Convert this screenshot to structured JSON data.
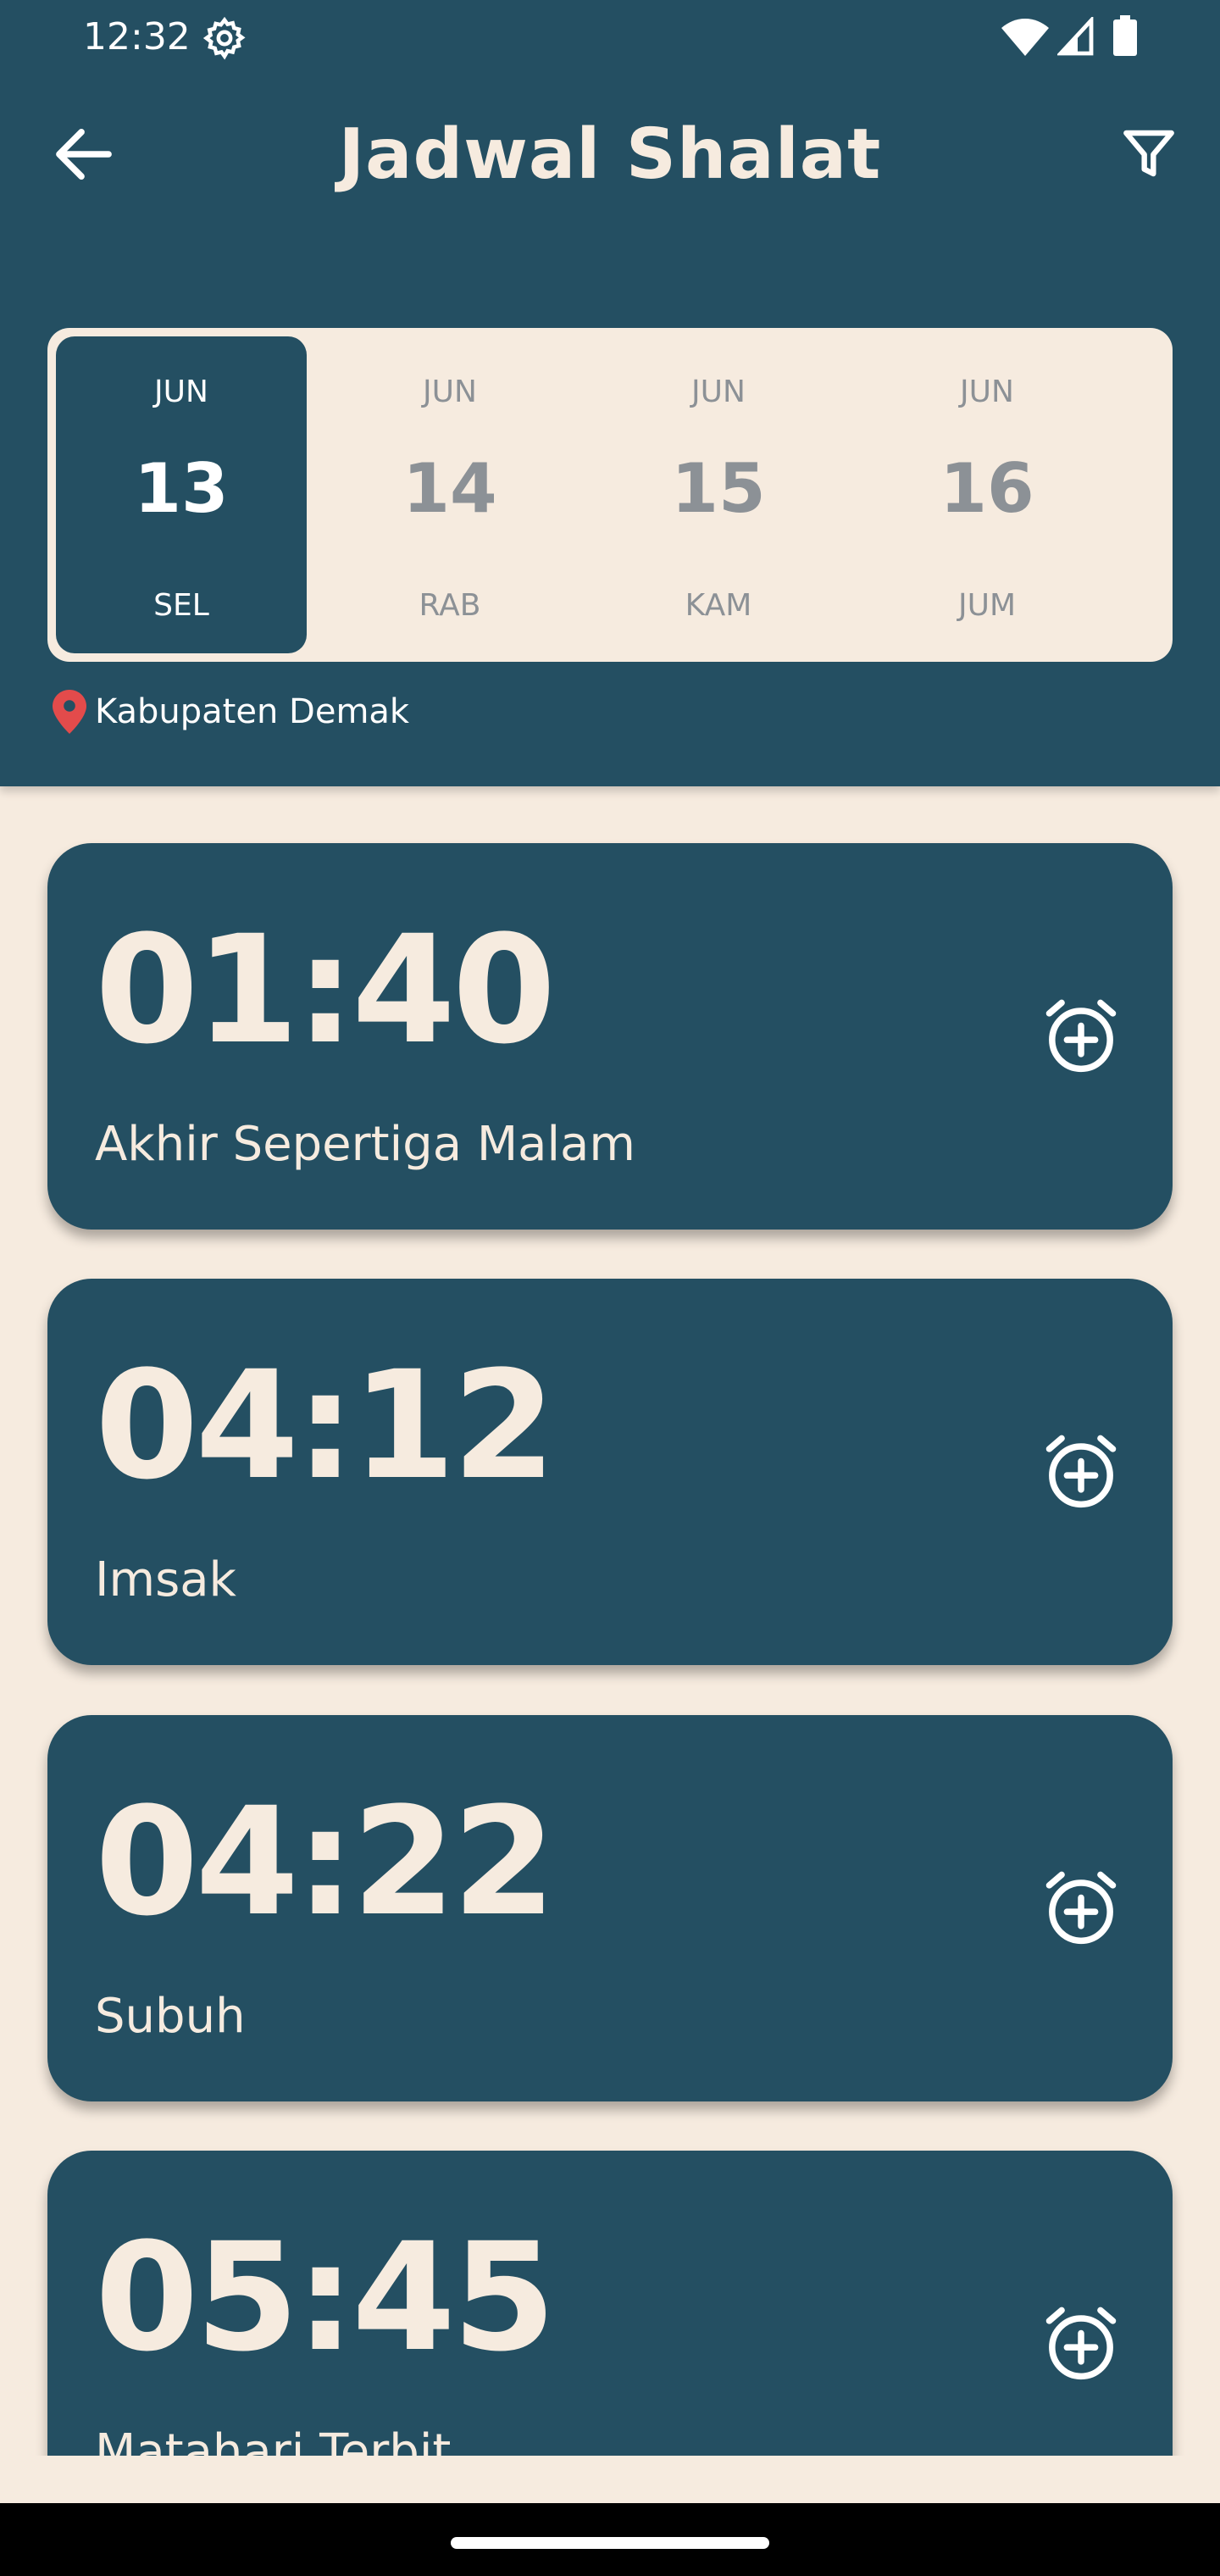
{
  "status_bar": {
    "time": "12:32",
    "icons": [
      "settings-gear-icon",
      "wifi-icon",
      "cell-signal-icon",
      "battery-icon"
    ]
  },
  "app_bar": {
    "title": "Jadwal Shalat",
    "back_icon": "arrow-left-icon",
    "filter_icon": "filter-funnel-icon"
  },
  "date_strip": {
    "selected_index": 0,
    "days": [
      {
        "month": "JUN",
        "day": "13",
        "weekday": "SEL"
      },
      {
        "month": "JUN",
        "day": "14",
        "weekday": "RAB"
      },
      {
        "month": "JUN",
        "day": "15",
        "weekday": "KAM"
      },
      {
        "month": "JUN",
        "day": "16",
        "weekday": "JUM"
      }
    ]
  },
  "location": {
    "label": "Kabupaten Demak",
    "icon": "map-pin-icon"
  },
  "prayer_times": [
    {
      "time": "01:40",
      "name": "Akhir Sepertiga Malam"
    },
    {
      "time": "04:12",
      "name": "Imsak"
    },
    {
      "time": "04:22",
      "name": "Subuh"
    },
    {
      "time": "05:45",
      "name": "Matahari Terbit"
    }
  ],
  "colors": {
    "primary": "#244f62",
    "background": "#f6ebdf",
    "accent_pin": "#e34b4b",
    "muted_text": "#8c9196"
  }
}
